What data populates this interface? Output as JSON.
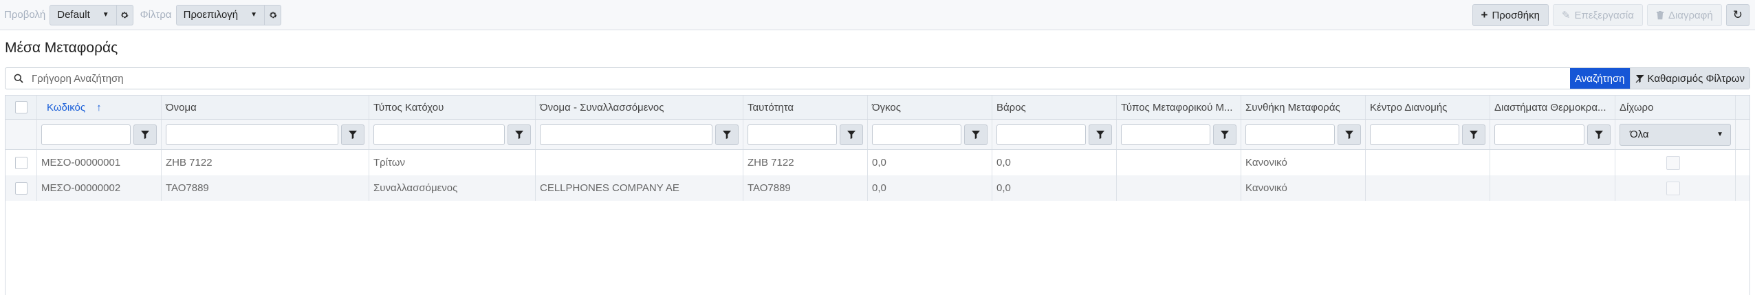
{
  "toolbar": {
    "view_label": "Προβολή",
    "view_value": "Default",
    "filter_label": "Φίλτρα",
    "filter_value": "Προεπιλογή",
    "add_label": "Προσθήκη",
    "edit_label": "Επεξεργασία",
    "delete_label": "Διαγραφή"
  },
  "page": {
    "title": "Μέσα Μεταφοράς"
  },
  "search": {
    "placeholder": "Γρήγορη Αναζήτηση",
    "search_button": "Αναζήτηση",
    "clear_filters_button": "Καθαρισμός Φίλτρων"
  },
  "table": {
    "columns": [
      "Κωδικός",
      "Όνομα",
      "Τύπος Κατόχου",
      "Όνομα - Συναλλασσόμενος",
      "Ταυτότητα",
      "Όγκος",
      "Βάρος",
      "Τύπος Μεταφορικού Μ...",
      "Συνθήκη Μεταφοράς",
      "Κέντρο Διανομής",
      "Διαστήματα Θερμοκρα...",
      "Δίχωρο"
    ],
    "sort_indicator": "↑",
    "dixoro_filter_value": "Όλα",
    "rows": [
      {
        "code": "ΜΕΣΟ-00000001",
        "name": "ΖΗΒ 7122",
        "owner_type": "Τρίτων",
        "partner_name": "",
        "identity": "ΖΗΒ 7122",
        "volume": "0,0",
        "weight": "0,0",
        "vehicle_type": "",
        "transport_condition": "Κανονικό",
        "distribution_center": "",
        "temperature_ranges": ""
      },
      {
        "code": "ΜΕΣΟ-00000002",
        "name": "ΤΑΟ7889",
        "owner_type": "Συναλλασσόμενος",
        "partner_name": "CELLPHONES COMPANY AE",
        "identity": "ΤΑΟ7889",
        "volume": "0,0",
        "weight": "0,0",
        "vehicle_type": "",
        "transport_condition": "Κανονικό",
        "distribution_center": "",
        "temperature_ranges": ""
      }
    ]
  },
  "colors": {
    "primary_blue": "#1656d6",
    "sorted_header": "#1a5fd8",
    "button_gray": "#dfe4ea"
  }
}
